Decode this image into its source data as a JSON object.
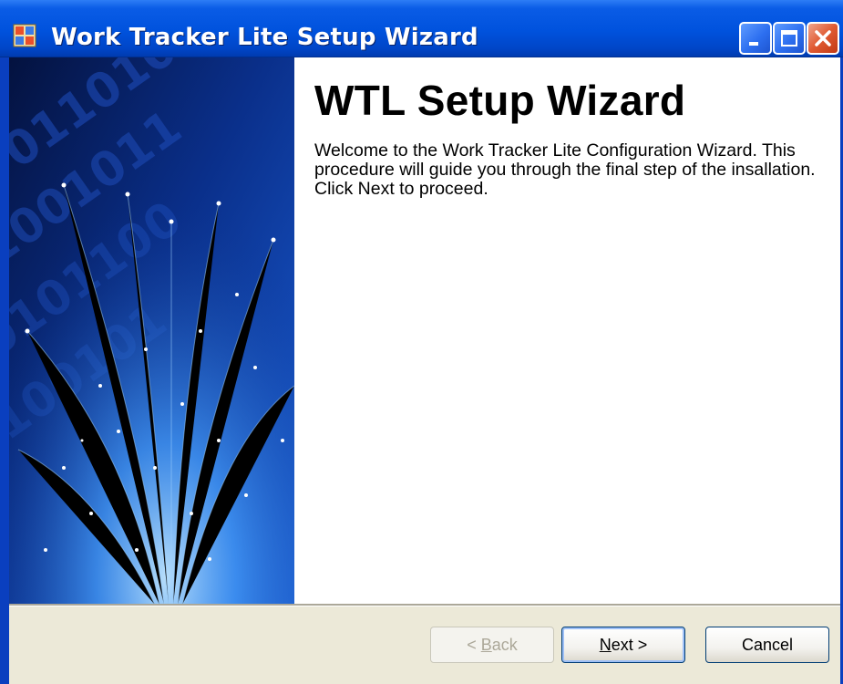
{
  "window": {
    "title": "Work Tracker Lite Setup Wizard",
    "icon": "app-window-icon",
    "controls": [
      "minimize-icon",
      "maximize-icon",
      "close-icon"
    ]
  },
  "main": {
    "heading": "WTL Setup Wizard",
    "description": "Welcome to the Work Tracker Lite Configuration Wizard. This procedure will guide you through the final step of the insallation. Click Next to proceed."
  },
  "buttons": {
    "back": {
      "prefix": "< ",
      "accel": "B",
      "rest": "ack",
      "enabled": false
    },
    "next": {
      "accel": "N",
      "rest": "ext >",
      "enabled": true
    },
    "cancel": {
      "label": "Cancel",
      "enabled": true
    }
  },
  "colors": {
    "titlebar": "#0052dd",
    "close_button": "#e05a32",
    "dialog_face": "#ece9d8"
  }
}
